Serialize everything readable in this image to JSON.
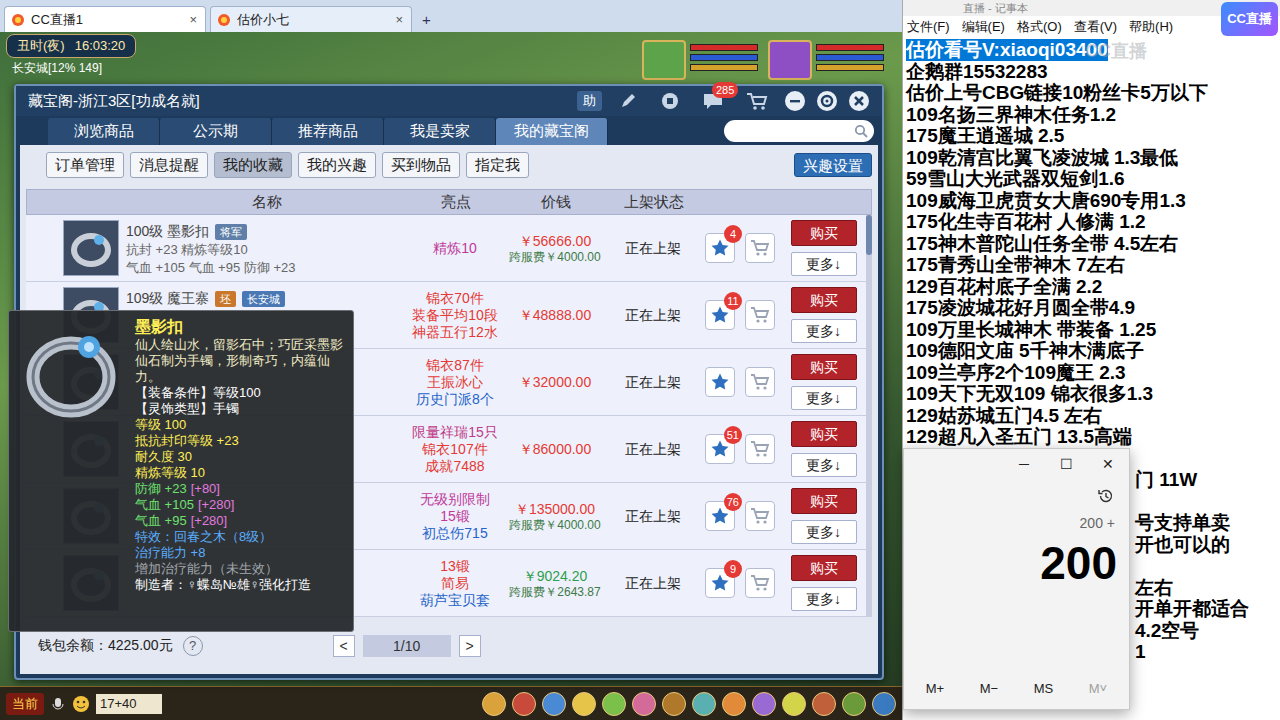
{
  "browser": {
    "tabs": [
      {
        "label": "CC直播1",
        "close": "×",
        "selected": true
      },
      {
        "label": "估价小七",
        "close": "×",
        "selected": false
      }
    ],
    "new_tab": "+"
  },
  "game": {
    "time_period": "丑时(夜)",
    "clock": "16:03:20",
    "location": "长安城[12% 149]",
    "chat_button": "当前",
    "chat_input": "17+40"
  },
  "shop": {
    "title": "藏宝阁-浙江3区[功成名就]",
    "help": "助",
    "messages_badge": "285",
    "tabs": [
      {
        "label": "浏览商品",
        "selected": false
      },
      {
        "label": "公示期",
        "selected": false
      },
      {
        "label": "推荐商品",
        "selected": false
      },
      {
        "label": "我是卖家",
        "selected": false
      },
      {
        "label": "我的藏宝阁",
        "selected": true
      }
    ],
    "subtabs": [
      {
        "label": "订单管理",
        "selected": false
      },
      {
        "label": "消息提醒",
        "selected": false
      },
      {
        "label": "我的收藏",
        "selected": true
      },
      {
        "label": "我的兴趣",
        "selected": false
      },
      {
        "label": "买到物品",
        "selected": false
      },
      {
        "label": "指定我",
        "selected": false
      }
    ],
    "interest_button": "兴趣设置",
    "columns": [
      "名称",
      "亮点",
      "价钱",
      "上架状态"
    ],
    "rows": [
      {
        "name": "100级 墨影扣",
        "tags": [
          {
            "text": "将军",
            "color": "#5f7fa8"
          }
        ],
        "details": [
          "抗封 +23 精炼等级10",
          "气血 +105 气血 +95 防御 +23"
        ],
        "highlights": [
          {
            "text": "精炼10",
            "color": "#c0399a"
          }
        ],
        "price": "￥56666.00",
        "price_color": "#e53935",
        "fee": "跨服费￥4000.00",
        "status": "正在上架",
        "starred": true,
        "favorites": "4",
        "buy": "购买",
        "more": "更多↓"
      },
      {
        "name": "109级 魔王寨",
        "tags": [
          {
            "text": "坯",
            "color": "#c9772b"
          },
          {
            "text": "长安城",
            "color": "#4a78b5"
          }
        ],
        "details": [],
        "highlights": [
          {
            "text": "锦衣70件",
            "color": "#e53935"
          },
          {
            "text": "装备平均10段",
            "color": "#e53935"
          },
          {
            "text": "神器五行12水",
            "color": "#e53935"
          }
        ],
        "price": "￥48888.00",
        "price_color": "#e53935",
        "status": "正在上架",
        "starred": true,
        "favorites": "11",
        "buy": "购买",
        "more": "更多↓"
      },
      {
        "tags": [],
        "details": [],
        "highlights": [
          {
            "text": "锦衣87件",
            "color": "#e53935"
          },
          {
            "text": "王振冰心",
            "color": "#e53935"
          },
          {
            "text": "历史门派8个",
            "color": "#2563c9"
          }
        ],
        "price": "￥32000.00",
        "price_color": "#e53935",
        "status": "正在上架",
        "starred": true,
        "buy": "购买",
        "more": "更多↓"
      },
      {
        "tags": [],
        "details": [],
        "highlights": [
          {
            "text": "限量祥瑞15只",
            "color": "#c03a8a"
          },
          {
            "text": "锦衣107件",
            "color": "#e53935"
          },
          {
            "text": "成就7488",
            "color": "#e53935"
          }
        ],
        "price": "￥86000.00",
        "price_color": "#e53935",
        "status": "正在上架",
        "starred": true,
        "favorites": "51",
        "buy": "购买",
        "more": "更多↓"
      },
      {
        "tags": [],
        "details": [],
        "highlights": [
          {
            "text": "无级别限制",
            "color": "#c0399a"
          },
          {
            "text": "15锻",
            "color": "#c0399a"
          },
          {
            "text": "初总伤715",
            "color": "#2563c9"
          }
        ],
        "price": "￥135000.00",
        "price_color": "#e53935",
        "fee": "跨服费￥4000.00",
        "status": "正在上架",
        "starred": true,
        "favorites": "76",
        "buy": "购买",
        "more": "更多↓"
      },
      {
        "tags": [],
        "details": [],
        "highlights": [
          {
            "text": "13锻",
            "color": "#e53935"
          },
          {
            "text": "简易",
            "color": "#e53935"
          },
          {
            "text": "葫芦宝贝套",
            "color": "#2563c9"
          }
        ],
        "price": "￥9024.20",
        "price_color": "#2e9e4f",
        "fee": "跨服费￥2643.87",
        "status": "正在上架",
        "starred": true,
        "favorites": "9",
        "buy": "购买",
        "more": "更多↓"
      }
    ],
    "wallet": "钱包余额：4225.00元",
    "help_mark": "?",
    "pager": {
      "prev": "<",
      "page": "1/10",
      "next": ">"
    }
  },
  "tooltip": {
    "title": "墨影扣",
    "description": "仙人绘山水，留影石中；巧匠采墨影仙石制为手镯，形制奇巧，内蕴仙力。",
    "requirements": [
      "【装备条件】等级100",
      "【灵饰类型】手镯"
    ],
    "attributes": [
      "等级 100",
      "抵抗封印等级 +23",
      "耐久度 30",
      "精炼等级 10"
    ],
    "stats": [
      {
        "text": "防御 +23",
        "bonus": "[+80]"
      },
      {
        "text": "气血 +105",
        "bonus": "[+280]"
      },
      {
        "text": "气血 +95",
        "bonus": "[+280]"
      }
    ],
    "effects": [
      "特效：回春之木（8级）",
      "治疗能力 +8"
    ],
    "inactive": "增加治疗能力（未生效）",
    "maker": "制造者：♀蝶岛№雄♀强化打造"
  },
  "notepad": {
    "title": "直播 - 记事本",
    "menu": [
      "文件(F)",
      "编辑(E)",
      "格式(O)",
      "查看(V)",
      "帮助(H)"
    ],
    "watermark": "CC直播",
    "lines": [
      {
        "text": "估价看号V:xiaoqi03400",
        "kind": "selected"
      },
      {
        "text": "企鹅群15532283",
        "kind": "full"
      },
      {
        "text": "估价上号CBG链接10粉丝卡5万以下",
        "kind": "full"
      },
      {
        "text": "109名扬三界神木任务1.2",
        "kind": "full"
      },
      {
        "text": "175魔王逍遥城 2.5",
        "kind": "full"
      },
      {
        "text": "109乾清宫比翼飞凌波城 1.3最低",
        "kind": "full"
      },
      {
        "text": "59雪山大光武器双短剑1.6",
        "kind": "full"
      },
      {
        "text": "109威海卫虎贲女大唐690专用1.3",
        "kind": "full"
      },
      {
        "text": "175化生寺百花村 人修满 1.2",
        "kind": "full"
      },
      {
        "text": "175神木普陀山任务全带 4.5左右",
        "kind": "full"
      },
      {
        "text": "175青秀山全带神木  7左右",
        "kind": "full"
      },
      {
        "text": "129百花村底子全满 2.2",
        "kind": "full"
      },
      {
        "text": "175凌波城花好月圆全带4.9",
        "kind": "full"
      },
      {
        "text": "109万里长城神木 带装备  1.25",
        "kind": "full"
      },
      {
        "text": "109德阳文庙 5千神木满底子",
        "kind": "full"
      },
      {
        "text": "109兰亭序2个109魔王 2.3",
        "kind": "full"
      },
      {
        "text": "109天下无双109  锦衣很多1.3",
        "kind": "full"
      },
      {
        "text": "129姑苏城五门4.5 左右",
        "kind": "full"
      },
      {
        "text": "129超凡入圣五门  13.5高端",
        "kind": "full"
      },
      {
        "kind": "hidden"
      },
      {
        "text": "门 11W",
        "kind": "partial"
      },
      {
        "kind": "hidden"
      },
      {
        "text": "号支持单卖",
        "kind": "partial"
      },
      {
        "text": "开也可以的",
        "kind": "partial"
      },
      {
        "kind": "hidden"
      },
      {
        "text": "左右",
        "kind": "partial"
      },
      {
        "text": "开单开都适合",
        "kind": "partial"
      },
      {
        "text": "4.2空号",
        "kind": "partial"
      },
      {
        "text": "1",
        "kind": "partial"
      }
    ]
  },
  "corner_logo": "CC直播",
  "calculator": {
    "controls": [
      "─",
      "☐",
      "✕"
    ],
    "expression": "200 +",
    "display": "200",
    "memory": [
      {
        "label": "M+",
        "disabled": false
      },
      {
        "label": "M−",
        "disabled": false
      },
      {
        "label": "MS",
        "disabled": false
      },
      {
        "label": "M˅",
        "disabled": true
      }
    ]
  }
}
